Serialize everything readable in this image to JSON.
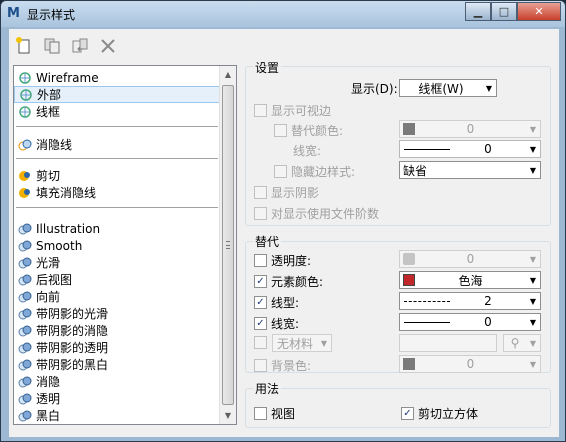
{
  "window": {
    "title": "显示样式"
  },
  "toolbar": {
    "icons": [
      "new-icon",
      "copy-icon",
      "import-icon",
      "delete-icon"
    ]
  },
  "styles": {
    "group1": [
      "Wireframe",
      "外部",
      "线框"
    ],
    "group2": [
      "消隐线"
    ],
    "group3": [
      "剪切",
      "填充消隐线"
    ],
    "group4": [
      "Illustration",
      "Smooth",
      "光滑",
      "后视图",
      "向前",
      "带阴影的光滑",
      "带阴影的消隐",
      "带阴影的透明",
      "带阴影的黑白",
      "消隐",
      "透明",
      "黑白"
    ],
    "selected": "外部"
  },
  "settings": {
    "title": "设置",
    "display_label": "显示(D):",
    "display_value": "线框(W)",
    "show_visible_edges": "显示可视边",
    "alt_color": "替代颜色:",
    "alt_color_value": "0",
    "line_weight": "线宽:",
    "line_weight_value": "0",
    "hidden_edge_style": "隐藏边样式:",
    "hidden_edge_style_value": "缺省",
    "show_shadows": "显示阴影",
    "use_file_levels": "对显示使用文件阶数"
  },
  "overrides": {
    "title": "替代",
    "transparency": "透明度:",
    "transparency_value": "0",
    "element_color": "元素颜色:",
    "element_color_value": "色海",
    "line_style": "线型:",
    "line_style_value": "2",
    "line_weight": "线宽:",
    "line_weight_value": "0",
    "material_value": "无材料",
    "background_color": "背景色:",
    "background_color_value": "0"
  },
  "usage": {
    "title": "用法",
    "view": "视图",
    "clip_cube": "剪切立方体"
  },
  "checks": {
    "show_visible_edges": false,
    "alt_color": false,
    "hidden_edge_style": false,
    "show_shadows": false,
    "use_file_levels": false,
    "transparency": false,
    "element_color": true,
    "line_style": true,
    "line_weight": true,
    "material": false,
    "background_color": false,
    "view": false,
    "clip_cube": true
  },
  "colors": {
    "accent": "#1f3c74",
    "close": "#c7402c",
    "element_color_swatch": "#c0282c"
  }
}
